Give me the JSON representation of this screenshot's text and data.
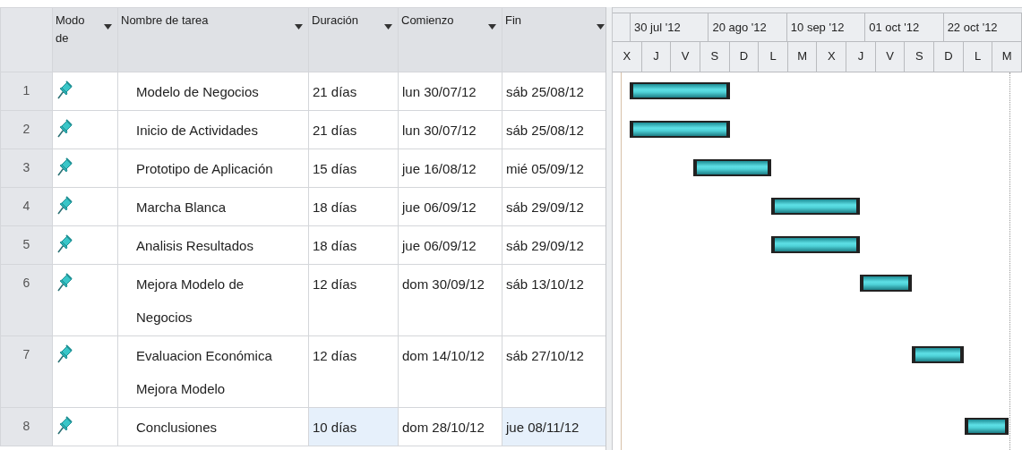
{
  "table": {
    "columns": [
      {
        "label": "Modo de"
      },
      {
        "label": "Nombre de tarea"
      },
      {
        "label": "Duración"
      },
      {
        "label": "Comienzo"
      },
      {
        "label": "Fin"
      }
    ],
    "rows": [
      {
        "number": "1",
        "name": "Modelo de Negocios",
        "duration": {
          "text": "21 días",
          "highlighted": false
        },
        "start": {
          "text": "lun 30/07/12",
          "highlighted": false
        },
        "end": {
          "text": "sáb 25/08/12",
          "highlighted": false
        }
      },
      {
        "number": "2",
        "name": "Inicio de Actividades",
        "duration": {
          "text": "21 días",
          "highlighted": false
        },
        "start": {
          "text": "lun 30/07/12",
          "highlighted": false
        },
        "end": {
          "text": "sáb 25/08/12",
          "highlighted": false
        }
      },
      {
        "number": "3",
        "name": "Prototipo de Aplicación",
        "duration": {
          "text": "15 días",
          "highlighted": false
        },
        "start": {
          "text": "jue 16/08/12",
          "highlighted": false
        },
        "end": {
          "text": "mié 05/09/12",
          "highlighted": false
        }
      },
      {
        "number": "4",
        "name": "Marcha Blanca",
        "duration": {
          "text": "18 días",
          "highlighted": false
        },
        "start": {
          "text": "jue 06/09/12",
          "highlighted": false
        },
        "end": {
          "text": "sáb 29/09/12",
          "highlighted": false
        }
      },
      {
        "number": "5",
        "name": "Analisis Resultados",
        "duration": {
          "text": "18 días",
          "highlighted": false
        },
        "start": {
          "text": "jue 06/09/12",
          "highlighted": false
        },
        "end": {
          "text": "sáb 29/09/12",
          "highlighted": false
        }
      },
      {
        "number": "6",
        "name": "Mejora Modelo de Negocios",
        "duration": {
          "text": "12 días",
          "highlighted": false
        },
        "start": {
          "text": "dom 30/09/12",
          "highlighted": false
        },
        "end": {
          "text": "sáb 13/10/12",
          "highlighted": false
        }
      },
      {
        "number": "7",
        "name": "Evaluacion Económica Mejora Modelo",
        "duration": {
          "text": "12 días",
          "highlighted": false
        },
        "start": {
          "text": "dom 14/10/12",
          "highlighted": false
        },
        "end": {
          "text": "sáb 27/10/12",
          "highlighted": false
        }
      },
      {
        "number": "8",
        "name": "Conclusiones",
        "duration": {
          "text": "10 días",
          "highlighted": true
        },
        "start": {
          "text": "dom 28/10/12",
          "highlighted": false
        },
        "end": {
          "text": "jue 08/11/12",
          "highlighted": true
        }
      }
    ]
  },
  "gantt": {
    "top_tier": [
      "30 jul '12",
      "20 ago '12",
      "10 sep '12",
      "01 oct '12",
      "22 oct '12"
    ],
    "bottom_tier": [
      "X",
      "J",
      "V",
      "S",
      "D",
      "L",
      "M",
      "X",
      "J",
      "V",
      "S",
      "D",
      "L",
      "M"
    ]
  }
}
